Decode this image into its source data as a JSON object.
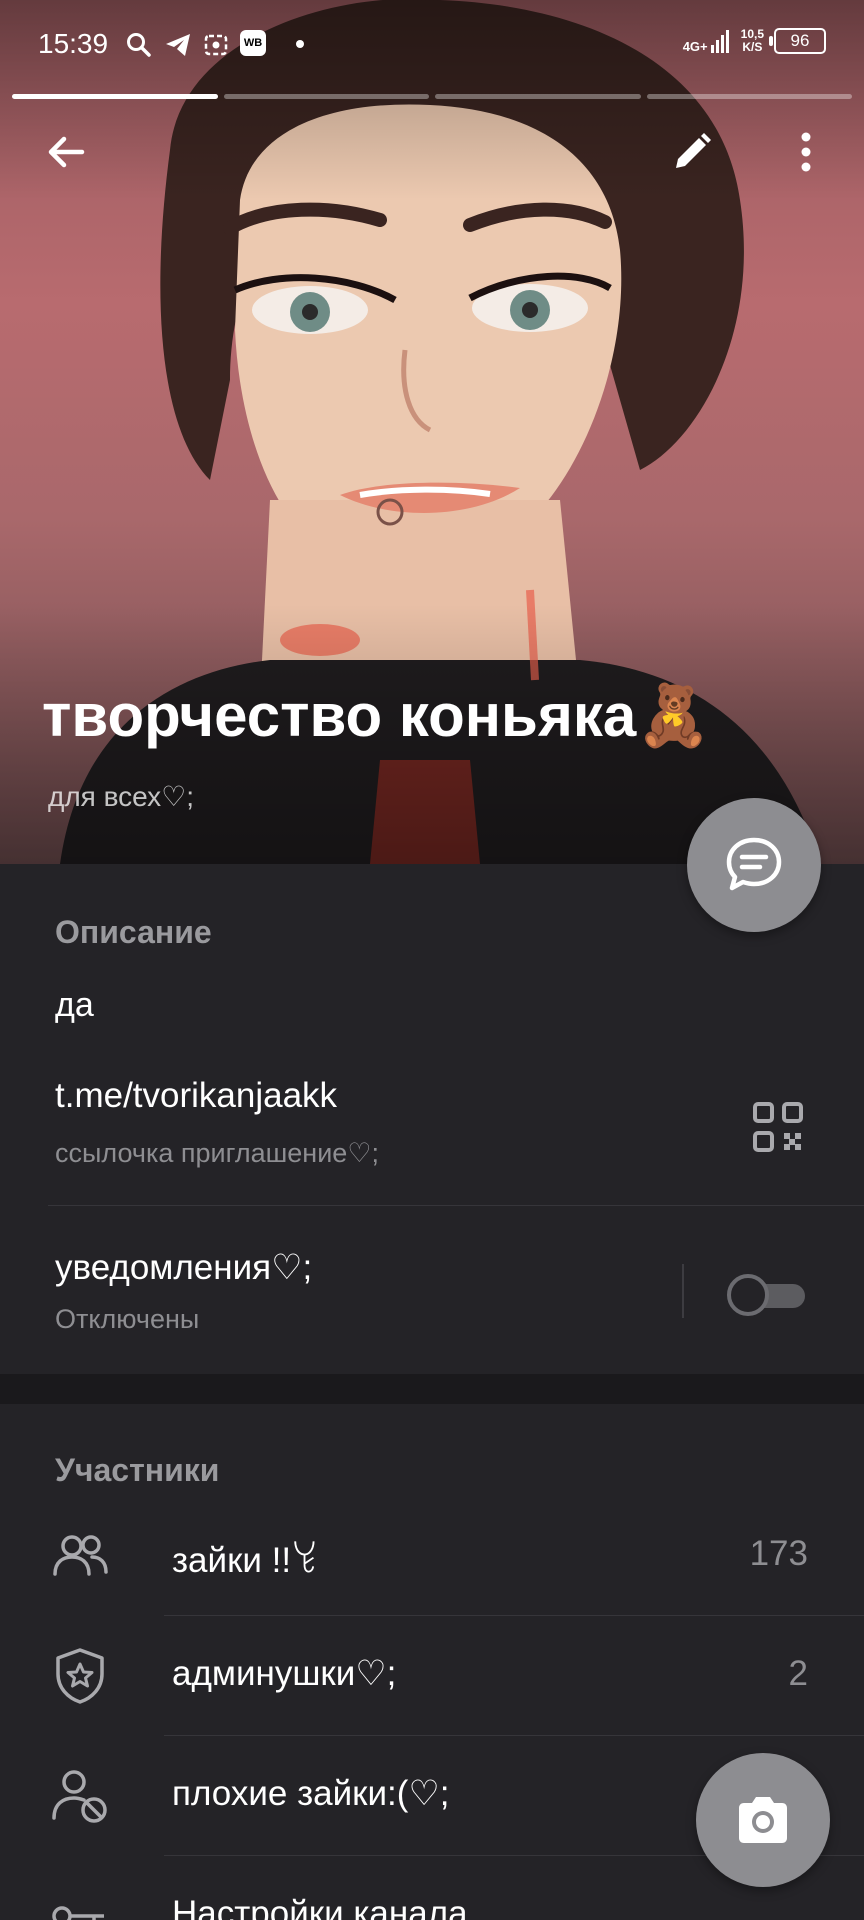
{
  "status_bar": {
    "time": "15:39",
    "network": "4G+",
    "speed_value": "10,5",
    "speed_unit": "K/S",
    "battery": "96",
    "app_icons": [
      "search-icon",
      "telegram-icon",
      "screenshot-icon",
      "wb-icon"
    ],
    "wb_label": "WB"
  },
  "story_progress": {
    "segments": 4,
    "active": 1
  },
  "channel": {
    "title": "творчество коньяка🧸",
    "subtitle": "для всех♡;"
  },
  "info": {
    "description_header": "Описание",
    "description": "да",
    "link": "t.me/tvorikanjaakk",
    "link_caption": "ссылочка приглашение♡;",
    "notifications_label": "уведомления♡;",
    "notifications_status": "Отключены",
    "notifications_enabled": false
  },
  "members": {
    "header": "Участники",
    "rows": [
      {
        "icon": "members-icon",
        "label": "зайки !!ꒀ",
        "count": "173"
      },
      {
        "icon": "admins-shield-icon",
        "label": "админушки♡;",
        "count": "2"
      },
      {
        "icon": "banned-user-icon",
        "label": "плохие зайки:(♡;",
        "count": ""
      },
      {
        "icon": "settings-key-icon",
        "label": "Настройки канала",
        "count": ""
      }
    ]
  },
  "colors": {
    "background": "#242327",
    "fab": "#8d8d91",
    "secondary_text": "#8e8e92",
    "cover_tone": "#b86b6f"
  }
}
